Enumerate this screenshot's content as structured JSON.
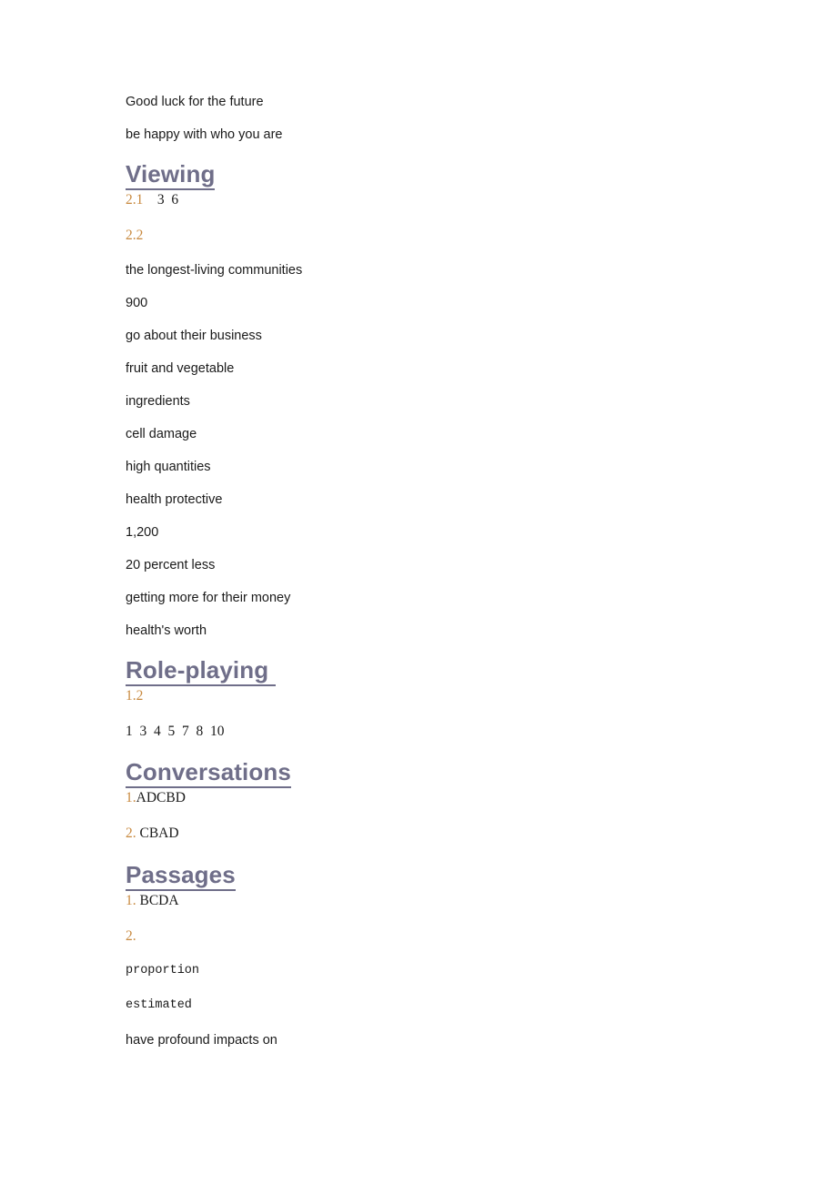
{
  "document": {
    "background_color": "#ffffff",
    "heading_color": "#6f6e89",
    "marker_color": "#c8893f",
    "body_color": "#1a1a1a",
    "blocks": [
      {
        "id": "b1",
        "kind": "paragraph-sans",
        "text": "Good luck for the future"
      },
      {
        "id": "b2",
        "kind": "paragraph-sans",
        "text": "be happy with who you are"
      },
      {
        "id": "h1",
        "kind": "heading",
        "text": "Viewing"
      },
      {
        "id": "b3",
        "kind": "answer",
        "marker": "2.1",
        "rest": "    3  6"
      },
      {
        "id": "b4",
        "kind": "answer",
        "marker": "2.2",
        "rest": ""
      },
      {
        "id": "b5",
        "kind": "paragraph-sans",
        "text": "the longest-living communities"
      },
      {
        "id": "b6",
        "kind": "paragraph-sans",
        "text": "900"
      },
      {
        "id": "b7",
        "kind": "paragraph-sans",
        "text": "go about their business"
      },
      {
        "id": "b8",
        "kind": "paragraph-sans",
        "text": "fruit and vegetable"
      },
      {
        "id": "b9",
        "kind": "paragraph-sans",
        "text": "ingredients"
      },
      {
        "id": "b10",
        "kind": "paragraph-sans",
        "text": "cell damage"
      },
      {
        "id": "b11",
        "kind": "paragraph-sans",
        "text": "high quantities"
      },
      {
        "id": "b12",
        "kind": "paragraph-sans",
        "text": "health protective"
      },
      {
        "id": "b13",
        "kind": "paragraph-sans",
        "text": "1,200"
      },
      {
        "id": "b14",
        "kind": "paragraph-sans",
        "text": "20 percent less"
      },
      {
        "id": "b15",
        "kind": "paragraph-sans",
        "text": "getting more for their money"
      },
      {
        "id": "b16",
        "kind": "paragraph-sans",
        "text": "health's worth"
      },
      {
        "id": "h2",
        "kind": "heading",
        "text": "Role-playing "
      },
      {
        "id": "b17",
        "kind": "answer",
        "marker": "1.2",
        "rest": ""
      },
      {
        "id": "b18",
        "kind": "paragraph-serif",
        "text": "1  3  4  5  7  8  10"
      },
      {
        "id": "h3",
        "kind": "heading",
        "text": "Conversations"
      },
      {
        "id": "b19",
        "kind": "answer",
        "marker": "1.",
        "rest": "ADCBD"
      },
      {
        "id": "b20",
        "kind": "answer",
        "marker": "2.",
        "rest": " CBAD"
      },
      {
        "id": "h4",
        "kind": "heading",
        "text": "Passages"
      },
      {
        "id": "b21",
        "kind": "answer",
        "marker": "1.",
        "rest": " BCDA"
      },
      {
        "id": "b22",
        "kind": "answer",
        "marker": "2.",
        "rest": ""
      },
      {
        "id": "b23",
        "kind": "paragraph-mono",
        "text": "proportion"
      },
      {
        "id": "b24",
        "kind": "paragraph-mono",
        "text": "estimated"
      },
      {
        "id": "b25",
        "kind": "paragraph-sans",
        "text": "have profound impacts on"
      }
    ]
  }
}
